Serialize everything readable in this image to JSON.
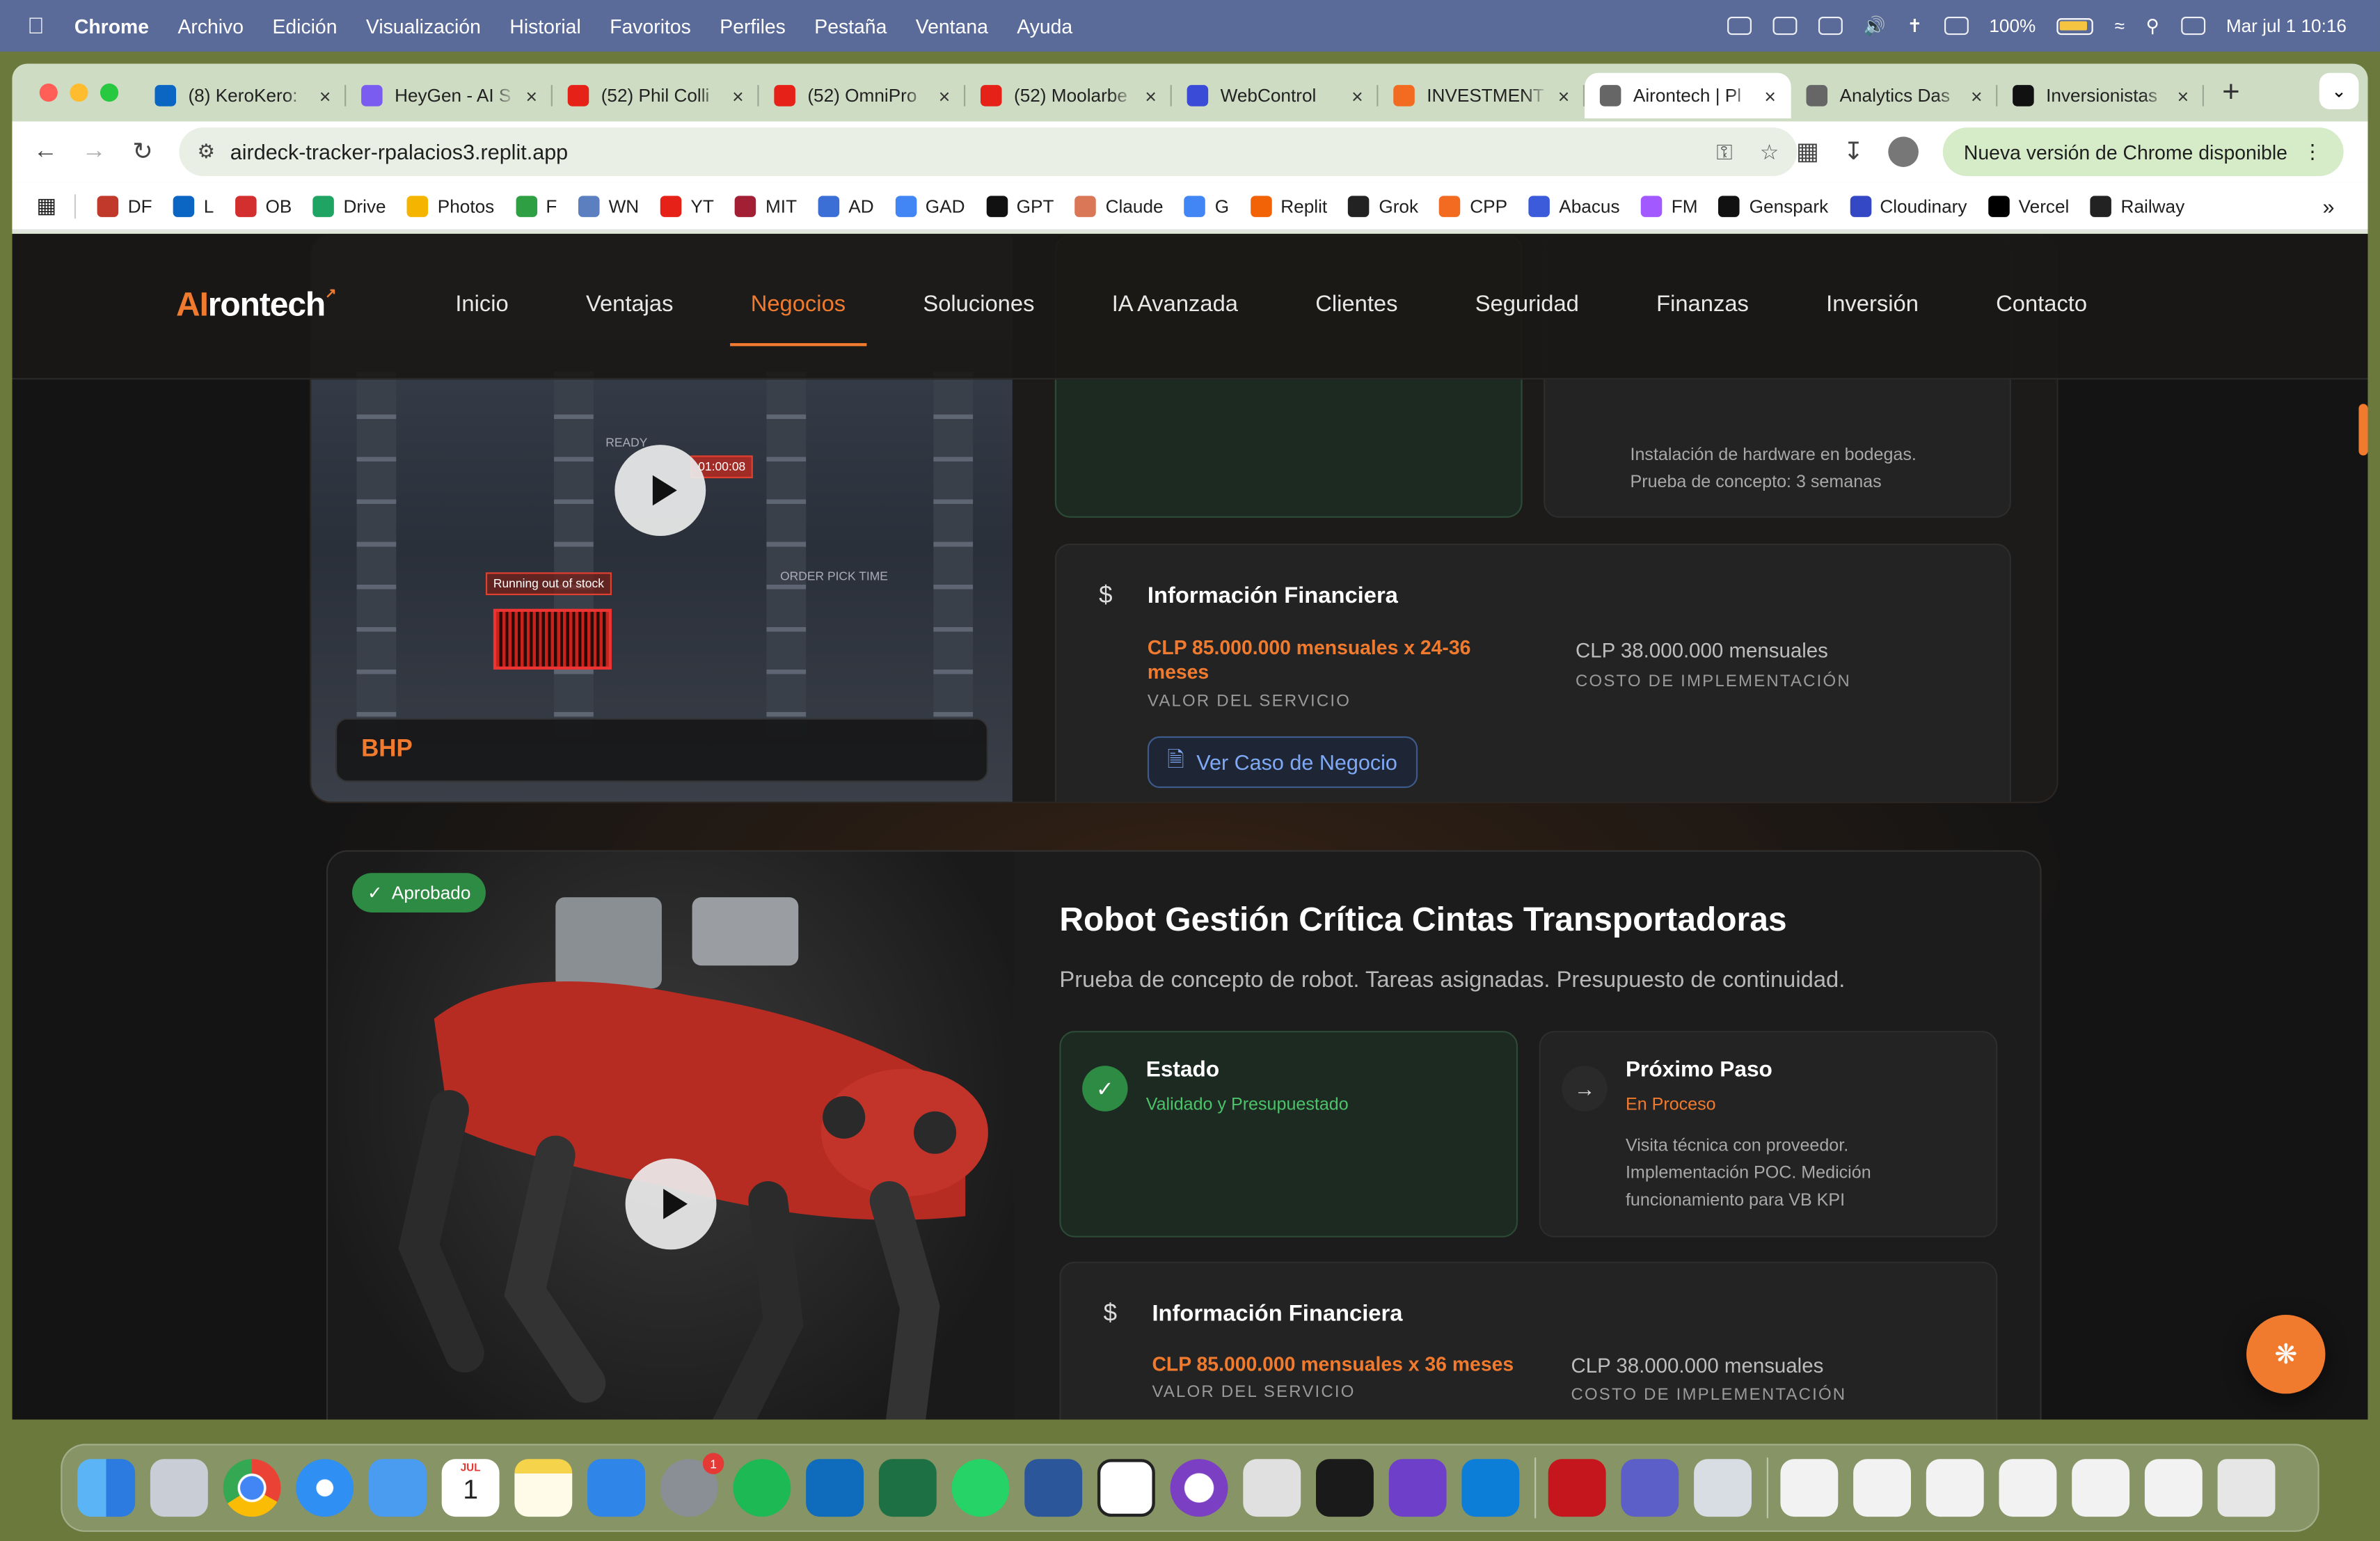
{
  "menubar": {
    "app": "Chrome",
    "items": [
      "Archivo",
      "Edición",
      "Visualización",
      "Historial",
      "Favoritos",
      "Perfiles",
      "Pestaña",
      "Ventana",
      "Ayuda"
    ],
    "battery": "100%",
    "datetime": "Mar jul 1  10:16"
  },
  "tabs": [
    {
      "title": "(8) KeroKero:",
      "color": "#0a66c2"
    },
    {
      "title": "HeyGen - AI S",
      "color": "#7b5cf0"
    },
    {
      "title": "(52) Phil Colli",
      "color": "#e62117"
    },
    {
      "title": "(52) OmniPro",
      "color": "#e62117"
    },
    {
      "title": "(52) Moolarbe",
      "color": "#e62117"
    },
    {
      "title": "WebControl",
      "color": "#3a4bd8"
    },
    {
      "title": "INVESTMENT",
      "color": "#f26b21"
    },
    {
      "title": "Airontech | Pl",
      "color": "#666666",
      "active": true
    },
    {
      "title": "Analytics Das",
      "color": "#666666"
    },
    {
      "title": "Inversionistas",
      "color": "#111111"
    }
  ],
  "address": {
    "url": "airdeck-tracker-rpalacios3.replit.app",
    "update_label": "Nueva versión de Chrome disponible"
  },
  "bookmarks": [
    {
      "label": "DF",
      "color": "#c0392b"
    },
    {
      "label": "L",
      "color": "#0a66c2"
    },
    {
      "label": "OB",
      "color": "#d32f2f"
    },
    {
      "label": "Drive",
      "color": "#1fa463"
    },
    {
      "label": "Photos",
      "color": "#f4b400"
    },
    {
      "label": "F",
      "color": "#2ea043"
    },
    {
      "label": "WN",
      "color": "#5b7fbf"
    },
    {
      "label": "YT",
      "color": "#e62117"
    },
    {
      "label": "MIT",
      "color": "#a31f34"
    },
    {
      "label": "AD",
      "color": "#3b6fd6"
    },
    {
      "label": "GAD",
      "color": "#4285f4"
    },
    {
      "label": "GPT",
      "color": "#111111"
    },
    {
      "label": "Claude",
      "color": "#d97757"
    },
    {
      "label": "G",
      "color": "#4285f4"
    },
    {
      "label": "Replit",
      "color": "#f26207"
    },
    {
      "label": "Grok",
      "color": "#222222"
    },
    {
      "label": "CPP",
      "color": "#f26b21"
    },
    {
      "label": "Abacus",
      "color": "#3b5bdb"
    },
    {
      "label": "FM",
      "color": "#a259ff"
    },
    {
      "label": "Genspark",
      "color": "#111111"
    },
    {
      "label": "Cloudinary",
      "color": "#3448c5"
    },
    {
      "label": "Vercel",
      "color": "#000000"
    },
    {
      "label": "Railway",
      "color": "#222222"
    }
  ],
  "site": {
    "logo_ai": "AI",
    "logo_rest": "rontech",
    "nav": [
      "Inicio",
      "Ventajas",
      "Negocios",
      "Soluciones",
      "IA Avanzada",
      "Clientes",
      "Seguridad",
      "Finanzas",
      "Inversión",
      "Contacto"
    ],
    "active_nav": "Negocios"
  },
  "card1": {
    "next_step_note_1": "Instalación de hardware en bodegas.",
    "next_step_note_2": "Prueba de concepto: 3 semanas",
    "fin_title": "Información Financiera",
    "service_value": "CLP 85.000.000 mensuales x 24-36 meses",
    "service_value_label": "VALOR DEL SERVICIO",
    "impl_cost": "CLP 38.000.000 mensuales",
    "impl_cost_label": "COSTO DE IMPLEMENTACIÓN",
    "case_button": "Ver Caso de Negocio",
    "client": "BHP",
    "overlay_texts": [
      "READY",
      "01:00:08",
      "Running out of stock",
      "ORDER PICK TIME"
    ]
  },
  "card2": {
    "badge": "Aprobado",
    "title": "Robot Gestión Crítica Cintas Transportadoras",
    "description": "Prueba de concepto de robot. Tareas asignadas. Presupuesto de continuidad.",
    "status_title": "Estado",
    "status_value": "Validado y Presupuestado",
    "next_title": "Próximo Paso",
    "next_value": "En Proceso",
    "next_note": "Visita técnica con proveedor. Implementación POC. Medición funcionamiento para VB KPI",
    "fin_title": "Información Financiera",
    "service_value": "CLP 85.000.000 mensuales x 36 meses",
    "service_value_label": "VALOR DEL SERVICIO",
    "impl_cost": "CLP 38.000.000 mensuales",
    "impl_cost_label": "COSTO DE IMPLEMENTACIÓN"
  },
  "dock": {
    "calendar_month": "JUL",
    "calendar_day": "1",
    "badge_count": "1",
    "icons": [
      "finder",
      "launchpad",
      "chrome",
      "safari",
      "mail",
      "calendar",
      "notes",
      "keynote",
      "system-settings",
      "spotify",
      "outlook",
      "excel",
      "whatsapp",
      "word",
      "calendar-31",
      "screen-recorder",
      "iphone-mirroring",
      "replit",
      "github",
      "vscode",
      "acrobat",
      "teams",
      "preview"
    ]
  }
}
